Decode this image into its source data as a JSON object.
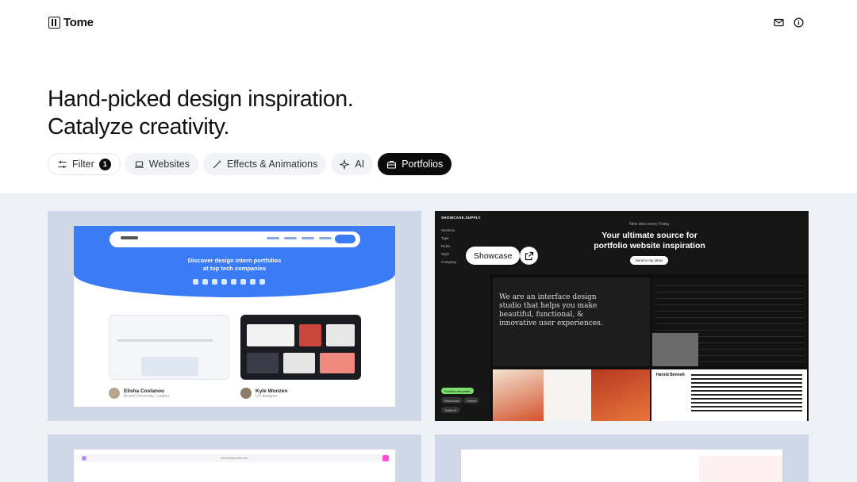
{
  "header": {
    "logo_text": "Tome",
    "icons": [
      "mail-icon",
      "info-icon"
    ]
  },
  "hero": {
    "line1": "Hand-picked design inspiration.",
    "line2": "Catalyze creativity."
  },
  "filters": {
    "filter_label": "Filter",
    "filter_count": "1",
    "chips": [
      {
        "label": "Websites",
        "icon": "laptop-icon",
        "active": false
      },
      {
        "label": "Effects & Animations",
        "icon": "magic-wand-icon",
        "active": false
      },
      {
        "label": "AI",
        "icon": "sparkle-icon",
        "active": false
      },
      {
        "label": "Portfolios",
        "icon": "briefcase-icon",
        "active": true
      }
    ]
  },
  "cards": {
    "card1": {
      "headline_line1": "Discover design intern portfolios",
      "headline_line2": "at top tech companies",
      "authors": [
        {
          "name": "Elisha Costanou",
          "sub": "Brunel University, London"
        },
        {
          "name": "Kyle Wonzen",
          "sub": "UX designer"
        }
      ]
    },
    "card2": {
      "brand": "SHOWCASE.SUPPLY",
      "sidebar": [
        "Sections",
        "Type",
        "Roles",
        "Style",
        "Company"
      ],
      "kicker": "New sites every Friday",
      "heading_line1": "Your ultimate source for",
      "heading_line2": "portfolio website inspiration",
      "cta": "Send to my inbox",
      "studio_text": "We are an interface design studio that helps you make beautiful, functional, & innovative user experiences.",
      "pills": [
        "Portfolio templates",
        "Resources",
        "Submit",
        "Twitter/X"
      ],
      "grid_name": "Harold Bennett",
      "showcase_label": "Showcase"
    },
    "card3": {
      "url": "linkedingrowth.com"
    }
  },
  "colors": {
    "accent": "#0b0b0b",
    "gallery_bg": "#eef2f7",
    "card_bg": "#cfd8e6",
    "blue": "#3b7cf5"
  }
}
